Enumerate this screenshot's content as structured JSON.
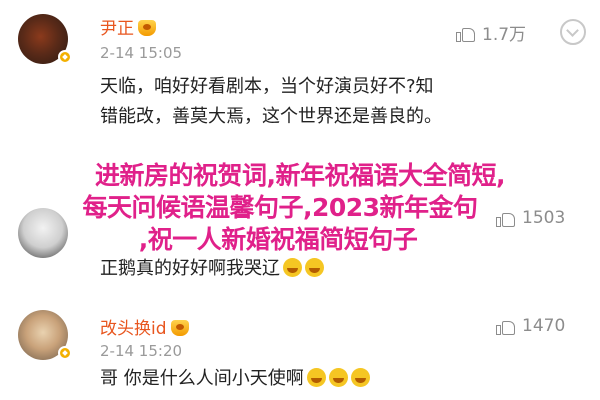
{
  "comments": [
    {
      "name": "尹正",
      "time": "2-14 15:05",
      "likes": "1.7万",
      "lines": [
        "天临，咱好好看剧本，当个好演员好不?知",
        "错能改，善莫大焉，这个世界还是善良的。"
      ]
    },
    {
      "name": "",
      "time": "",
      "likes": "1503",
      "lines": [
        "正鹅真的好好啊我哭辽"
      ]
    },
    {
      "name": "改头换id",
      "time": "2-14 15:20",
      "likes": "1470",
      "lines": [
        "哥 你是什么人间小天使啊"
      ]
    }
  ],
  "overlay": {
    "line1": "进新房的祝贺词,新年祝福语大全简短,",
    "line2": "每天问候语温馨句子,2023新年金句",
    "line3": ",祝一人新婚祝福简短句子"
  },
  "colors": {
    "username": "#e8561f",
    "overlay_text": "#e0218a",
    "meta": "#9a9a9a"
  },
  "icons": [
    "like-thumb-icon",
    "more-chevron-icon",
    "crown-badge-icon",
    "vip-badge-icon",
    "crying-emoji-icon"
  ]
}
